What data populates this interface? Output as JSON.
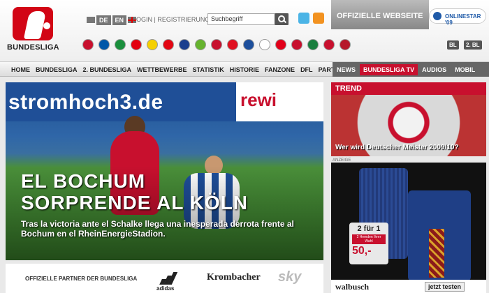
{
  "header": {
    "logo_text": "BUNDESLIGA",
    "languages": [
      "DE",
      "EN"
    ],
    "login_label": "LOGIN | REGISTRIERUNG",
    "search_placeholder": "Suchbegriff",
    "official_label": "OFFIZIELLE WEBSEITE",
    "onlinestar_label": "ONLINESTAR '09",
    "club_nav": [
      "BL",
      "2. BL"
    ],
    "club_colors": [
      "#c8102e",
      "#0057a8",
      "#1a8f3c",
      "#e3000f",
      "#f5d000",
      "#e30613",
      "#1b3f8e",
      "#65b32e",
      "#c8102e",
      "#e01020",
      "#1d4f9c",
      "#ffffff",
      "#e2001a",
      "#c8102e",
      "#1a7f3f",
      "#c8102e",
      "#b6172a"
    ]
  },
  "nav": {
    "left": [
      "HOME",
      "BUNDESLIGA",
      "2. BUNDESLIGA",
      "WETTBEWERBE",
      "STATISTIK",
      "HISTORIE",
      "FANZONE",
      "DFL",
      "PARTNER"
    ],
    "right": [
      "NEWS",
      "BUNDESLIGA TV",
      "AUDIOS",
      "MOBIL"
    ]
  },
  "hero": {
    "banner_left": "stromhoch3.de",
    "banner_right": "rewi",
    "headline_line1": "EL BOCHUM",
    "headline_line2": "SORPRENDE AL KÖLN",
    "description": "Tras la victoria ante el Schalke llega una inesperada derrota frente al Bochum en el RheinEnergieStadion."
  },
  "partners": {
    "label": "OFFIZIELLE PARTNER DER BUNDESLIGA",
    "adidas": "adidas",
    "krombacher": "Krombacher",
    "sky": "sky"
  },
  "trend": {
    "title": "TREND",
    "caption": "Wer wird Deutscher Meister 2009/10?"
  },
  "ad": {
    "label": "ANZEIGE",
    "offer_top": "2 für 1",
    "offer_sub": "2 Hemden Ihrer Wahl",
    "price": "50,-",
    "brand": "walbusch",
    "cta": "jetzt testen"
  }
}
